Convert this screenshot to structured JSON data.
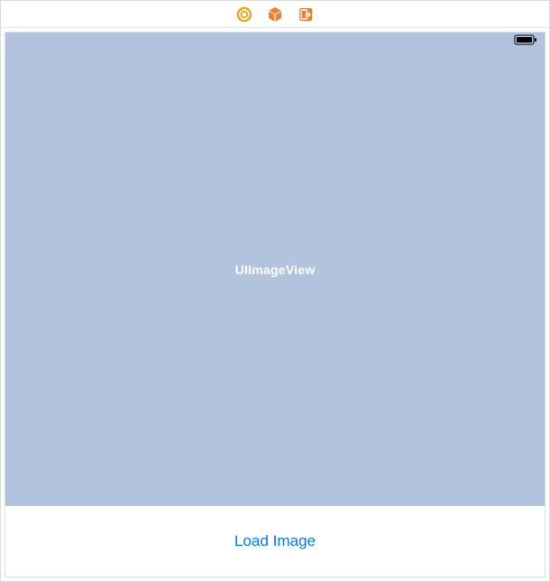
{
  "toolbar": {
    "items": [
      {
        "name": "class-identity-icon"
      },
      {
        "name": "object-cube-icon"
      },
      {
        "name": "exit-segue-icon"
      }
    ]
  },
  "canvas": {
    "imageview_label": "UIImageView",
    "button_label": "Load Image"
  },
  "colors": {
    "imageview_bg": "#b2c3dd",
    "tint": "#007aff",
    "toolbar_orange": "#f0802f",
    "toolbar_yellow": "#f5a623"
  }
}
